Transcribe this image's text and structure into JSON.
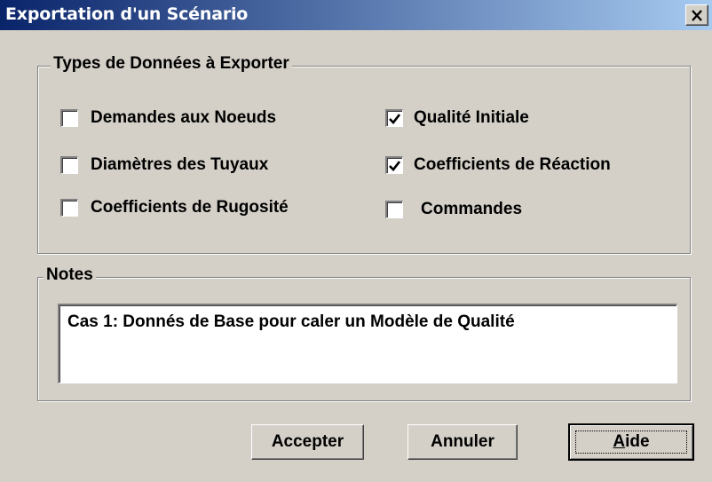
{
  "window": {
    "title": "Exportation d'un Scénario",
    "close_glyph": "×"
  },
  "types_group": {
    "legend": "Types de Données à Exporter",
    "items": [
      {
        "label": "Demandes aux Noeuds",
        "checked": false
      },
      {
        "label": "Diamètres des Tuyaux",
        "checked": false
      },
      {
        "label": "Coefficients de Rugosité",
        "checked": false
      },
      {
        "label": "Qualité Initiale",
        "checked": true
      },
      {
        "label": "Coefficients de Réaction",
        "checked": true
      },
      {
        "label": "Commandes",
        "checked": false
      }
    ]
  },
  "notes_group": {
    "legend": "Notes",
    "text": "Cas 1: Donnés de Base pour caler un Modèle de Qualité"
  },
  "buttons": {
    "accept": "Accepter",
    "cancel": "Annuler",
    "help_mnemonic": "A",
    "help_rest": "ide"
  },
  "colors": {
    "title_gradient_start": "#0a246a",
    "title_gradient_end": "#a6caf0",
    "face": "#d4d0c8"
  },
  "icons": {
    "close": "close-icon",
    "check": "checkmark-icon"
  }
}
